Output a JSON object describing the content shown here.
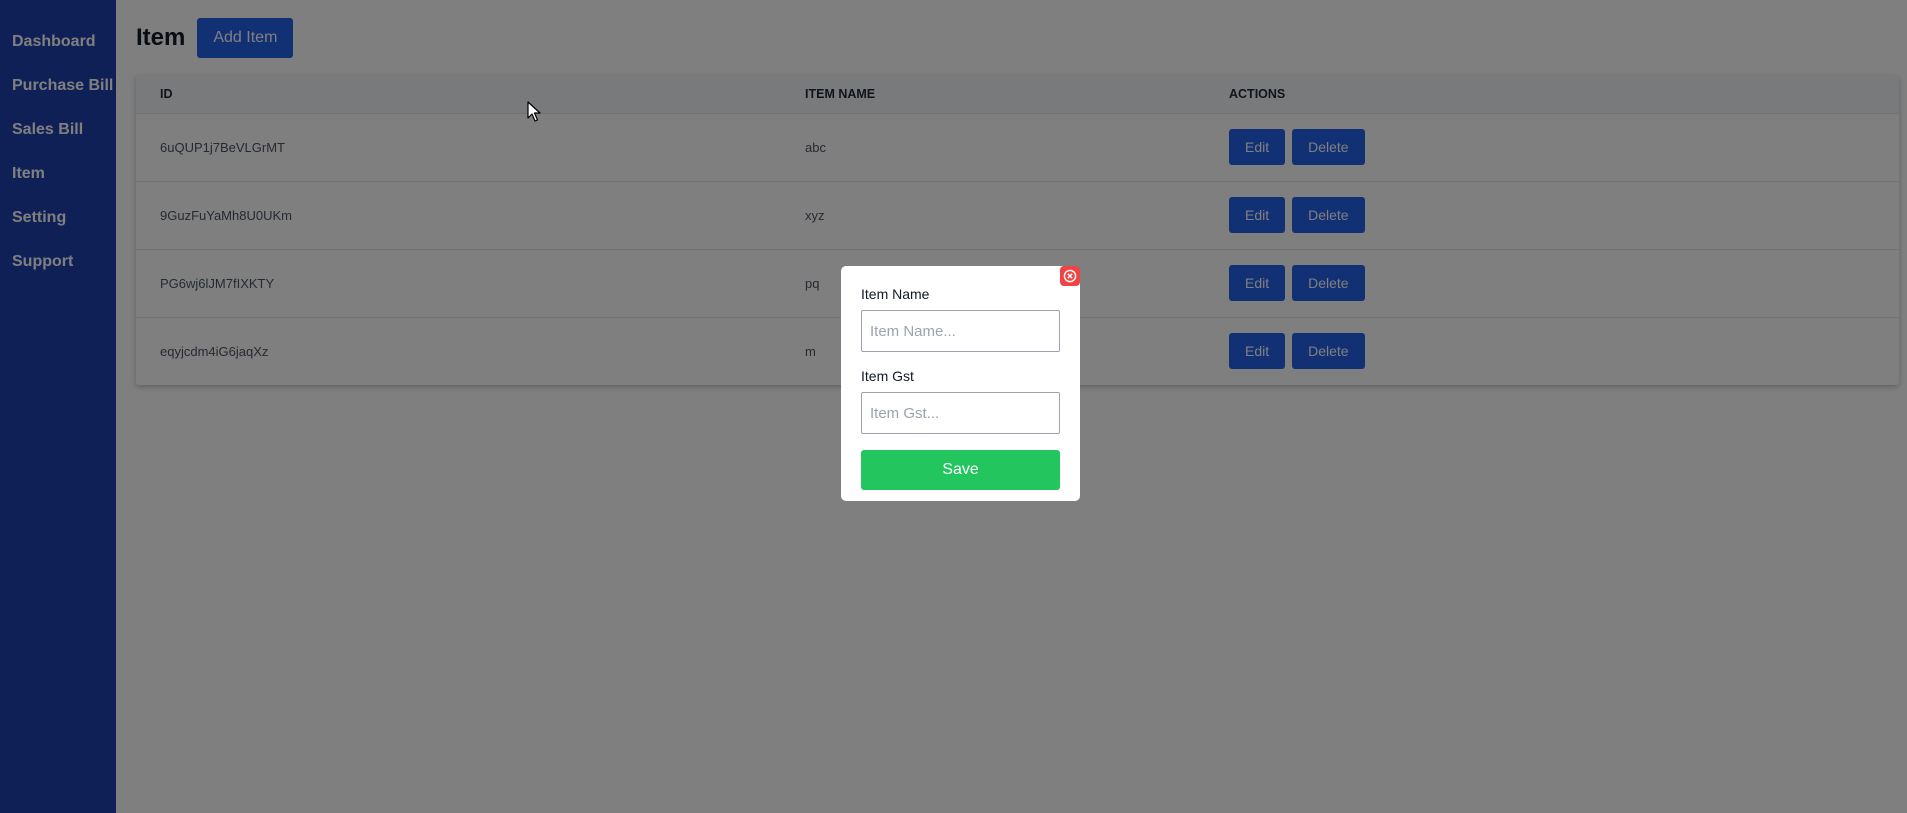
{
  "sidebar": {
    "items": [
      {
        "label": "Dashboard"
      },
      {
        "label": "Purchase Bill"
      },
      {
        "label": "Sales Bill"
      },
      {
        "label": "Item"
      },
      {
        "label": "Setting"
      },
      {
        "label": "Support"
      }
    ]
  },
  "header": {
    "title": "Item",
    "add_button_label": "Add Item"
  },
  "table": {
    "columns": [
      "ID",
      "ITEM NAME",
      "ACTIONS"
    ],
    "rows": [
      {
        "id": "6uQUP1j7BeVLGrMT",
        "name": "abc"
      },
      {
        "id": "9GuzFuYaMh8U0UKm",
        "name": "xyz"
      },
      {
        "id": "PG6wj6lJM7fIXKTY",
        "name": "pq"
      },
      {
        "id": "eqyjcdm4iG6jaqXz",
        "name": "m"
      }
    ],
    "edit_label": "Edit",
    "delete_label": "Delete"
  },
  "modal": {
    "item_name_label": "Item Name",
    "item_name_placeholder": "Item Name...",
    "item_name_value": "",
    "item_gst_label": "Item Gst",
    "item_gst_placeholder": "Item Gst...",
    "item_gst_value": "",
    "save_label": "Save"
  },
  "colors": {
    "sidebar_bg": "#1e40af",
    "primary_button": "#2563eb",
    "save_button": "#22c55e",
    "close_button": "#ef4444"
  },
  "icons": {
    "close": "close-circle-icon",
    "cursor": "mouse-cursor-icon"
  }
}
